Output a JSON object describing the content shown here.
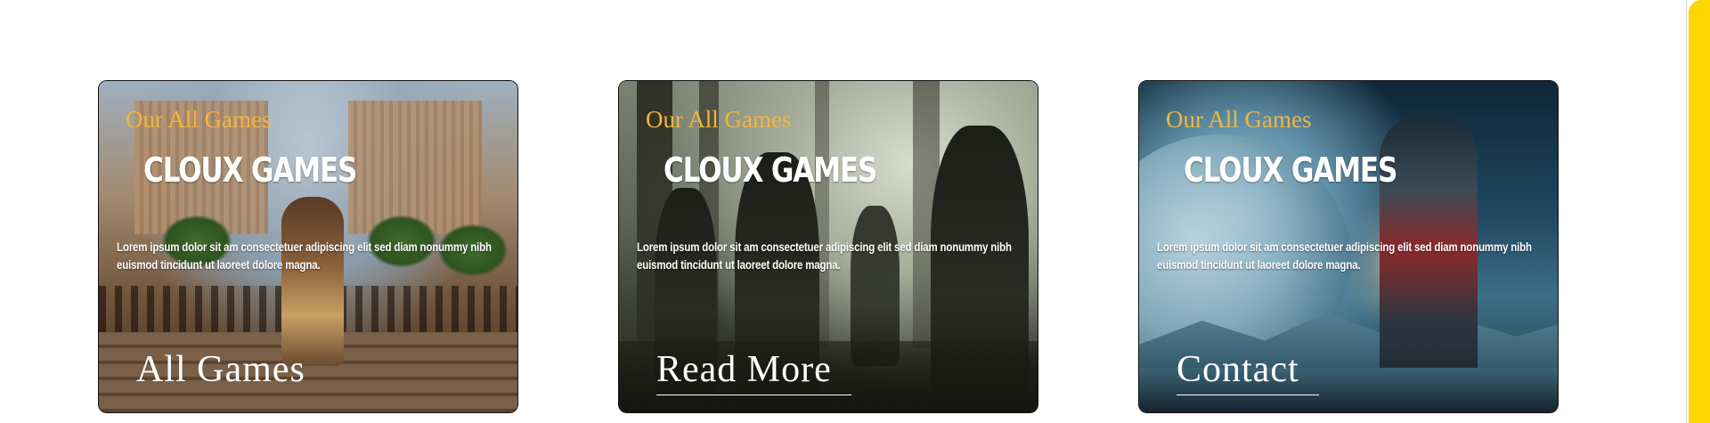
{
  "cards": [
    {
      "subtitle": "Our All Games",
      "brand": "CLOUX GAMES",
      "description": "Lorem ipsum dolor sit am consectetuer adipiscing elit sed diam nonummy nibh euismod tincidunt ut laoreet dolore magna.",
      "action_label": "All Games",
      "image_icon": "temple-scene-image"
    },
    {
      "subtitle": "Our All Games",
      "brand": "CLOUX GAMES",
      "description": "Lorem ipsum dolor sit am consectetuer adipiscing elit sed diam nonummy nibh euismod tincidunt ut laoreet dolore magna.",
      "action_label": "Read More",
      "image_icon": "soldiers-forest-image"
    },
    {
      "subtitle": "Our All Games",
      "brand": "CLOUX GAMES",
      "description": "Lorem ipsum dolor sit am consectetuer adipiscing elit sed diam nonummy nibh euismod tincidunt ut laoreet dolore magna.",
      "action_label": "Contact",
      "image_icon": "space-astronaut-image"
    }
  ],
  "colors": {
    "subtitle": "#f2b63c",
    "scrollbar_thumb": "#ffd400",
    "text": "#ffffff"
  }
}
